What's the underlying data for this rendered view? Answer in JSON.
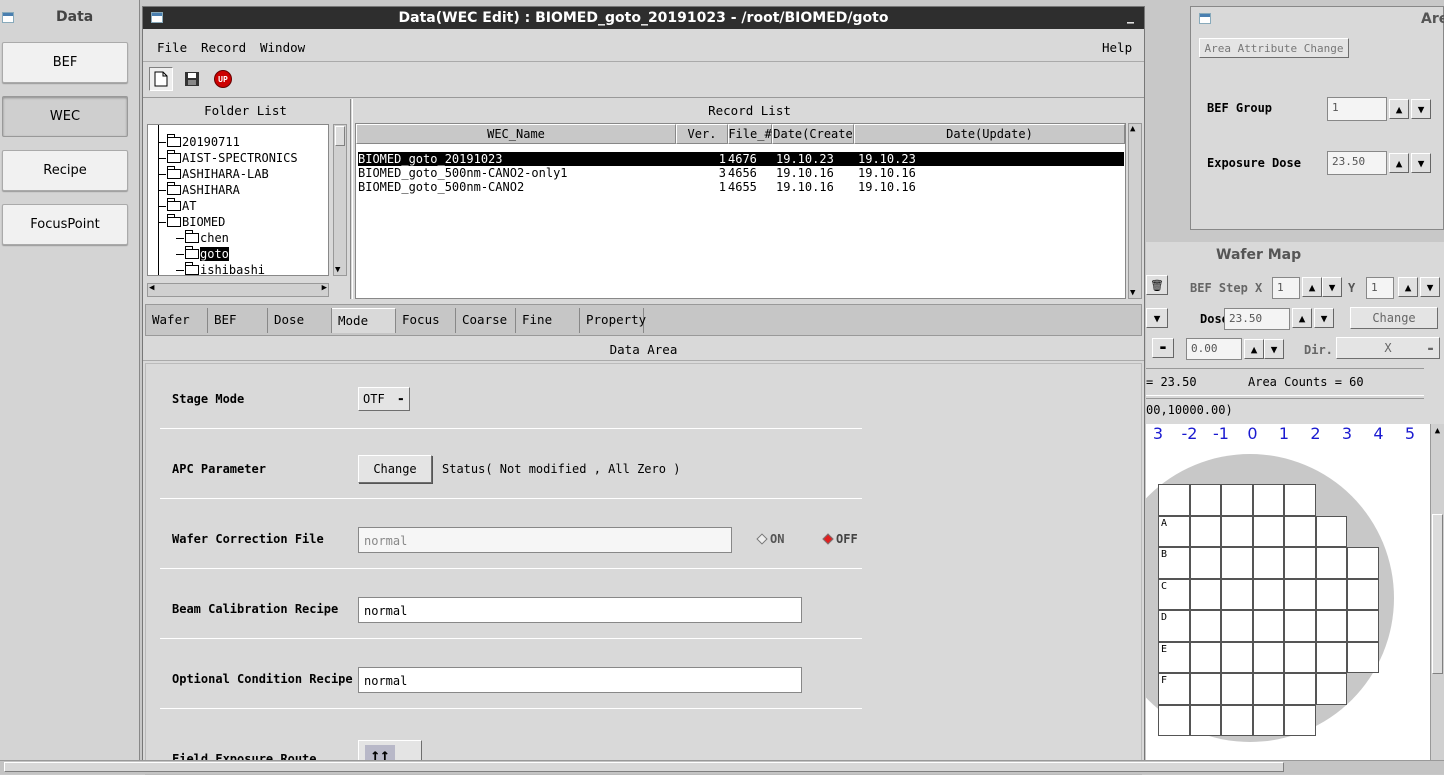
{
  "left_panel": {
    "title": "Data",
    "buttons": [
      "BEF",
      "WEC",
      "Recipe",
      "FocusPoint"
    ]
  },
  "main_window": {
    "title": "Data(WEC Edit) : BIOMED_goto_20191023 - /root/BIOMED/goto",
    "minimize_label": "_",
    "menu": {
      "file": "File",
      "record": "Record",
      "window": "Window",
      "help": "Help"
    },
    "toolbar": {
      "upload_label": "UP"
    },
    "folder_list": {
      "title": "Folder List",
      "items": [
        "20190711",
        "AIST-SPECTRONICS",
        "ASHIHARA-LAB",
        "ASHIHARA",
        "AT",
        "BIOMED",
        "chen",
        "goto",
        "ishibashi"
      ],
      "selected": "goto"
    },
    "record_list": {
      "title": "Record List",
      "columns": [
        "WEC_Name",
        "Ver.",
        "File_#",
        "Date(Create",
        "Date(Update)"
      ],
      "rows": [
        {
          "name": "BIOMED_goto_20191023",
          "ver": "1",
          "file": "4676",
          "created": "19.10.23",
          "updated": "19.10.23"
        },
        {
          "name": "BIOMED_goto_500nm-CANO2-only1",
          "ver": "3",
          "file": "4656",
          "created": "19.10.16",
          "updated": "19.10.16"
        },
        {
          "name": "BIOMED_goto_500nm-CANO2",
          "ver": "1",
          "file": "4655",
          "created": "19.10.16",
          "updated": "19.10.16"
        }
      ]
    },
    "tabs": [
      "Wafer",
      "BEF",
      "Dose",
      "Mode",
      "Focus",
      "Coarse",
      "Fine",
      "Property"
    ],
    "active_tab": "Mode",
    "data_area": {
      "title": "Data Area",
      "stage_mode_label": "Stage Mode",
      "stage_mode_value": "OTF",
      "apc_label": "APC Parameter",
      "apc_button": "Change",
      "apc_status": "Status( Not modified , All Zero )",
      "wafer_corr_label": "Wafer Correction File",
      "wafer_corr_value": "normal",
      "on_label": "ON",
      "off_label": "OFF",
      "beam_cal_label": "Beam Calibration Recipe",
      "beam_cal_value": "normal",
      "optional_label": "Optional Condition Recipe",
      "optional_value": "normal",
      "field_route_label": "Field Exposure Route"
    }
  },
  "area_window": {
    "title": "Are",
    "change_button": "Area Attribute Change",
    "bef_group_label": "BEF Group",
    "bef_group_value": "1",
    "exposure_dose_label": "Exposure Dose",
    "exposure_dose_value": "23.50"
  },
  "wafer_map": {
    "title": "Wafer Map",
    "bef_step_label": "BEF Step X",
    "step_x_value": "1",
    "y_label": "Y",
    "step_y_value": "1",
    "dose_label": "Dose",
    "dose_value": "23.50",
    "change_button": "Change",
    "offset_value": "0.00",
    "dir_label": "Dir.",
    "dir_value": "X",
    "dose_readout": "= 23.50",
    "area_counts": "Area Counts = 60",
    "coords": "00,10000.00)",
    "column_labels": [
      "3",
      "-2",
      "-1",
      "0",
      "1",
      "2",
      "3",
      "4",
      "5"
    ],
    "row_labels": [
      "A",
      "B",
      "C",
      "D",
      "E",
      "F"
    ]
  }
}
